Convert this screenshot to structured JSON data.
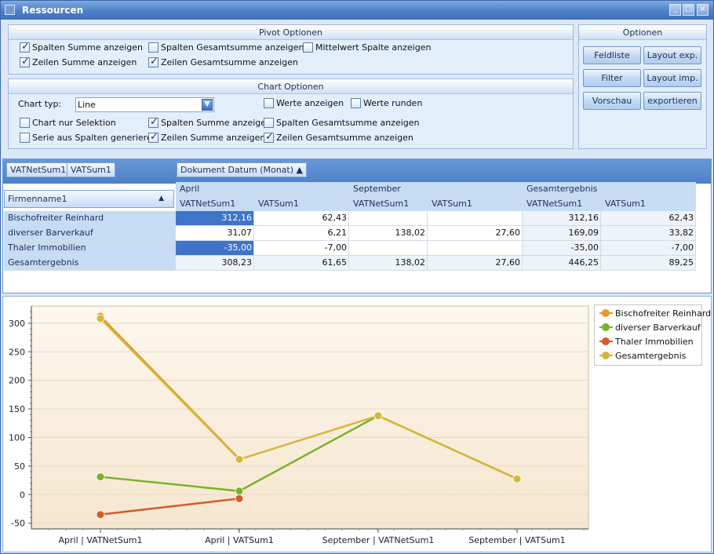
{
  "window": {
    "title": "Ressourcen"
  },
  "pivot_options": {
    "title": "Pivot Optionen",
    "checks": [
      {
        "label": "Spalten Summe anzeigen",
        "checked": true
      },
      {
        "label": "Spalten Gesamtsumme anzeigen",
        "checked": false
      },
      {
        "label": "Mittelwert Spalte anzeigen",
        "checked": false
      },
      {
        "label": "Zeilen Summe anzeigen",
        "checked": true
      },
      {
        "label": "Zeilen Gesamtsumme anzeigen",
        "checked": true
      }
    ]
  },
  "chart_options": {
    "title": "Chart Optionen",
    "chart_type_label": "Chart typ:",
    "chart_type_value": "Line",
    "checks": [
      {
        "label": "Werte anzeigen",
        "checked": false
      },
      {
        "label": "Werte runden",
        "checked": false
      },
      {
        "label": "Chart nur Selektion",
        "checked": false
      },
      {
        "label": "Spalten Summe anzeigen",
        "checked": true
      },
      {
        "label": "Spalten Gesamtsumme anzeigen",
        "checked": false
      },
      {
        "label": "Serie aus Spalten generieren",
        "checked": false
      },
      {
        "label": "Zeilen Summe anzeigen",
        "checked": true
      },
      {
        "label": "Zeilen Gesamtsumme anzeigen",
        "checked": true
      }
    ]
  },
  "options": {
    "title": "Optionen",
    "buttons": [
      "Feldliste",
      "Layout exp.",
      "Filter",
      "Layout imp.",
      "Vorschau",
      "exportieren"
    ]
  },
  "pivot": {
    "data_fields": [
      "VATNetSum1",
      "VATSum1"
    ],
    "column_field": "Dokument Datum (Monat)",
    "row_field": "Firmenname1",
    "column_groups": [
      "April",
      "September",
      "Gesamtergebnis"
    ],
    "value_headers": [
      "VATNetSum1",
      "VATSum1",
      "VATNetSum1",
      "VATSum1",
      "VATNetSum1",
      "VATSum1"
    ],
    "rows": [
      {
        "label": "Bischofreiter Reinhard",
        "values": [
          "312,16",
          "62,43",
          "",
          "",
          "312,16",
          "62,43"
        ]
      },
      {
        "label": "diverser Barverkauf",
        "values": [
          "31,07",
          "6,21",
          "138,02",
          "27,60",
          "169,09",
          "33,82"
        ]
      },
      {
        "label": "Thaler Immobilien",
        "values": [
          "-35,00",
          "-7,00",
          "",
          "",
          "-35,00",
          "-7,00"
        ]
      },
      {
        "label": "Gesamtergebnis",
        "values": [
          "308,23",
          "61,65",
          "138,02",
          "27,60",
          "446,25",
          "89,25"
        ]
      }
    ]
  },
  "chart_data": {
    "type": "line",
    "categories": [
      "April | VATNetSum1",
      "April | VATSum1",
      "September | VATNetSum1",
      "September | VATSum1"
    ],
    "ylim": [
      -60,
      330
    ],
    "yticks": [
      -50,
      0,
      50,
      100,
      150,
      200,
      250,
      300
    ],
    "grid": true,
    "legend_position": "right",
    "series": [
      {
        "name": "Bischofreiter Reinhard",
        "color": "#e09a2c",
        "values": [
          312.16,
          62.43,
          null,
          null
        ]
      },
      {
        "name": "diverser Barverkauf",
        "color": "#78b42a",
        "values": [
          31.07,
          6.21,
          138.02,
          27.6
        ]
      },
      {
        "name": "Thaler Immobilien",
        "color": "#d55a2a",
        "values": [
          -35,
          -7,
          null,
          null
        ]
      },
      {
        "name": "Gesamtergebnis",
        "color": "#d7b63a",
        "values": [
          308.23,
          61.65,
          138.02,
          27.6
        ]
      }
    ]
  }
}
